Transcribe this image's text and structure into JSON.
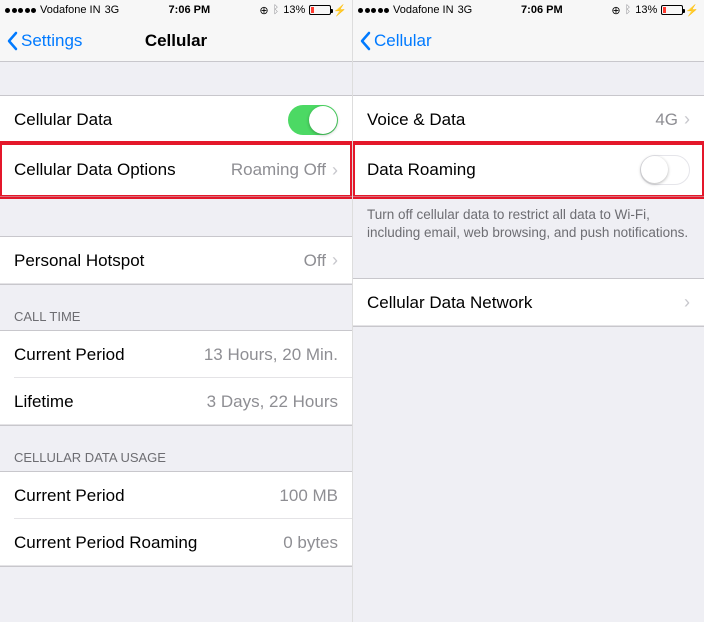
{
  "status": {
    "carrier": "Vodafone IN",
    "network": "3G",
    "time": "7:06 PM",
    "battery_pct": "13%",
    "battery_fill": "13%"
  },
  "left": {
    "back_label": "Settings",
    "title": "Cellular",
    "cellular_data_label": "Cellular Data",
    "cellular_data_on": true,
    "options_label": "Cellular Data Options",
    "options_value": "Roaming Off",
    "hotspot_label": "Personal Hotspot",
    "hotspot_value": "Off",
    "call_time_header": "CALL TIME",
    "call_current_label": "Current Period",
    "call_current_value": "13 Hours, 20 Min.",
    "call_lifetime_label": "Lifetime",
    "call_lifetime_value": "3 Days, 22 Hours",
    "usage_header": "CELLULAR DATA USAGE",
    "usage_current_label": "Current Period",
    "usage_current_value": "100 MB",
    "usage_roaming_label": "Current Period Roaming",
    "usage_roaming_value": "0 bytes"
  },
  "right": {
    "back_label": "Cellular",
    "voice_label": "Voice & Data",
    "voice_value": "4G",
    "roaming_label": "Data Roaming",
    "roaming_on": false,
    "footer_text": "Turn off cellular data to restrict all data to Wi-Fi, including email, web browsing, and push notifications.",
    "network_label": "Cellular Data Network"
  }
}
